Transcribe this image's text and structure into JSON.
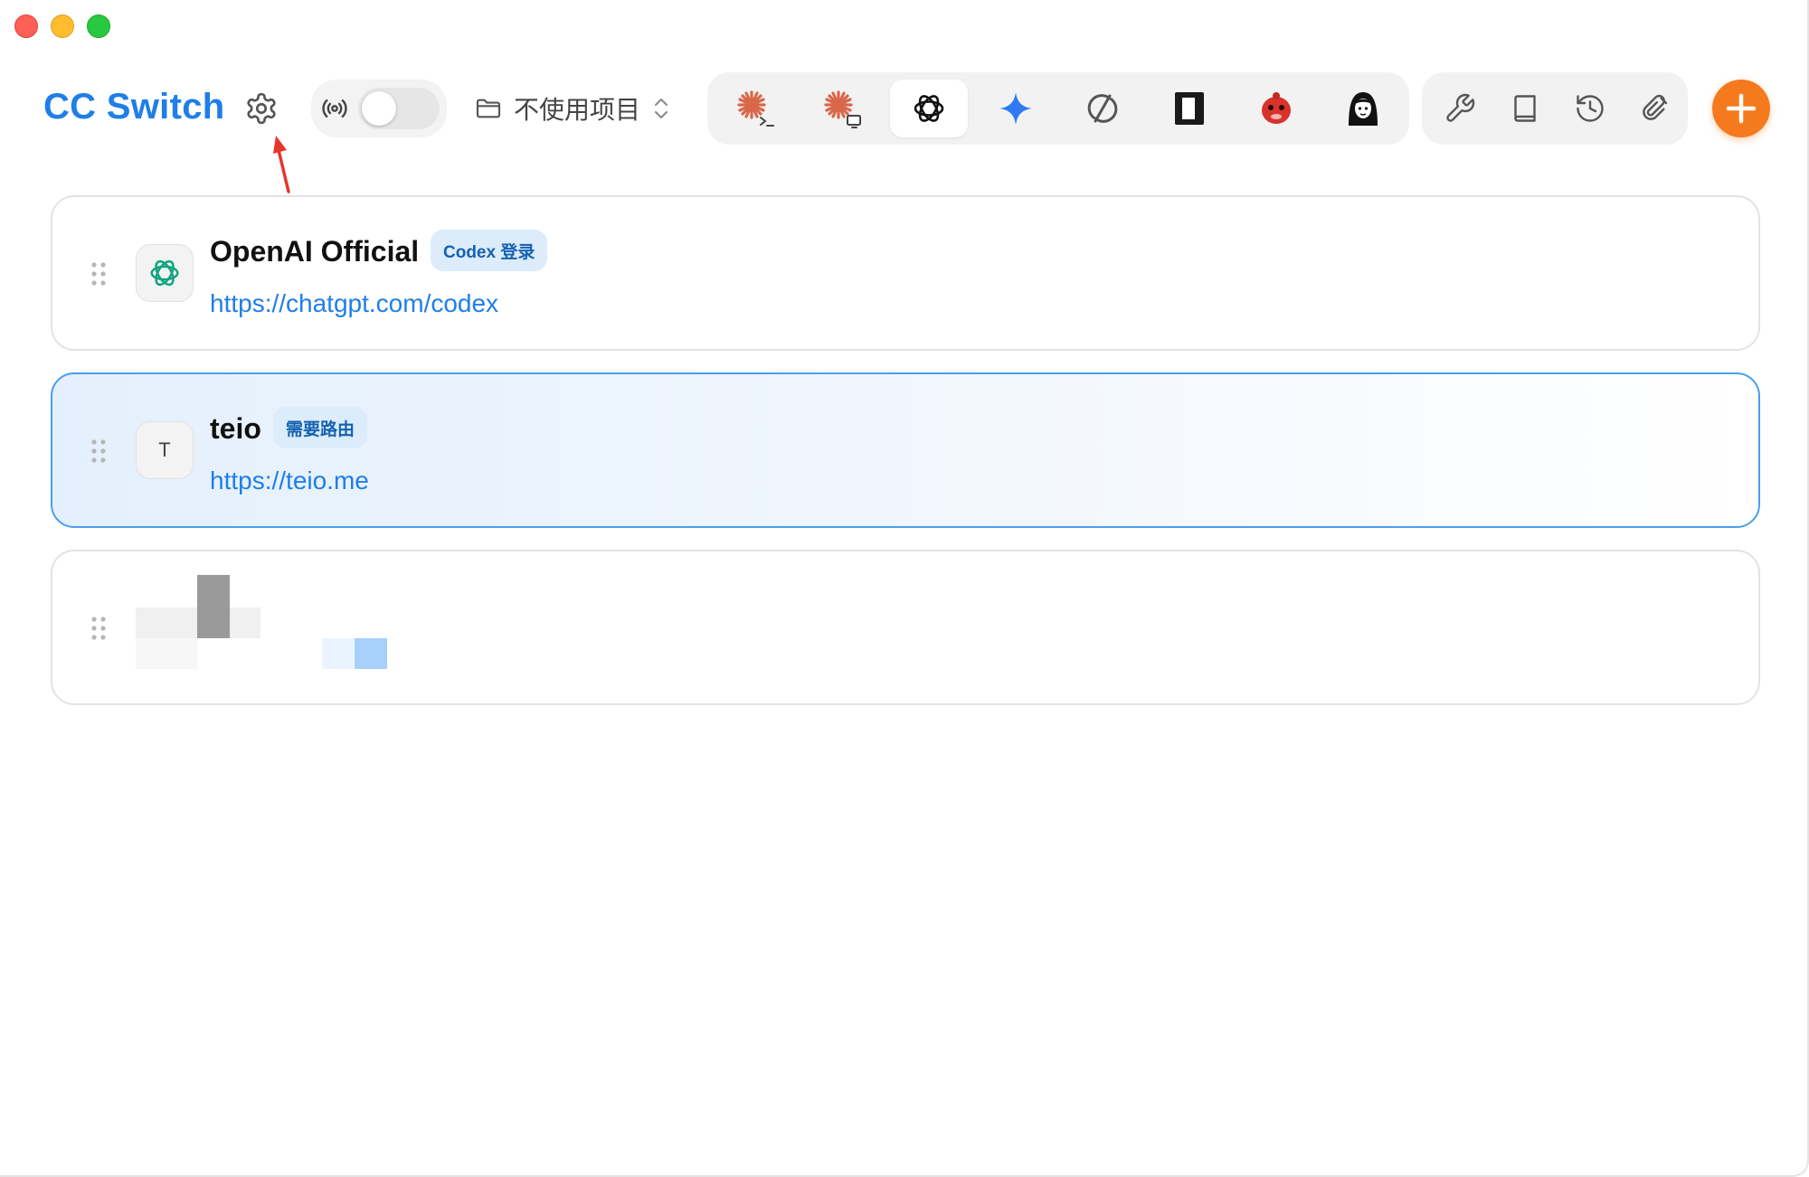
{
  "window": {
    "traffic_lights": [
      "close",
      "minimize",
      "maximize"
    ]
  },
  "header": {
    "app_title": "CC Switch",
    "settings_icon": "gear-icon",
    "proxy_icon": "radio-waves-icon",
    "proxy_toggle_on": false,
    "project_select": {
      "label": "不使用项目",
      "icon": "folder-icon"
    },
    "app_tabs": [
      {
        "name": "claude-code",
        "icon": "claude-terminal-icon",
        "active": false
      },
      {
        "name": "claude-desktop",
        "icon": "claude-desktop-icon",
        "active": false
      },
      {
        "name": "codex",
        "icon": "openai-icon",
        "active": true
      },
      {
        "name": "gemini",
        "icon": "gemini-sparkle-icon",
        "active": false
      },
      {
        "name": "opencode",
        "icon": "slashed-circle-icon",
        "active": false
      },
      {
        "name": "cursor",
        "icon": "dark-square-icon",
        "active": false
      },
      {
        "name": "red-bot",
        "icon": "red-bot-icon",
        "active": false
      },
      {
        "name": "portrait",
        "icon": "portrait-icon",
        "active": false
      }
    ],
    "tools": [
      {
        "name": "wrench",
        "icon": "wrench-icon"
      },
      {
        "name": "book",
        "icon": "book-icon"
      },
      {
        "name": "history",
        "icon": "history-icon"
      },
      {
        "name": "attachment",
        "icon": "paperclip-icon"
      }
    ],
    "add_icon": "plus-icon",
    "accent_color": "#1f7ee8",
    "add_color": "#f57a1e"
  },
  "annotation": {
    "arrow_color": "#e8352b"
  },
  "providers": [
    {
      "name": "OpenAI Official",
      "badge": "Codex 登录",
      "url": "https://chatgpt.com/codex",
      "avatar_icon": "openai-icon",
      "active": false
    },
    {
      "name": "teio",
      "badge": "需要路由",
      "url": "https://teio.me",
      "avatar_letter": "T",
      "active": true
    },
    {
      "redacted": true,
      "active": false
    }
  ]
}
